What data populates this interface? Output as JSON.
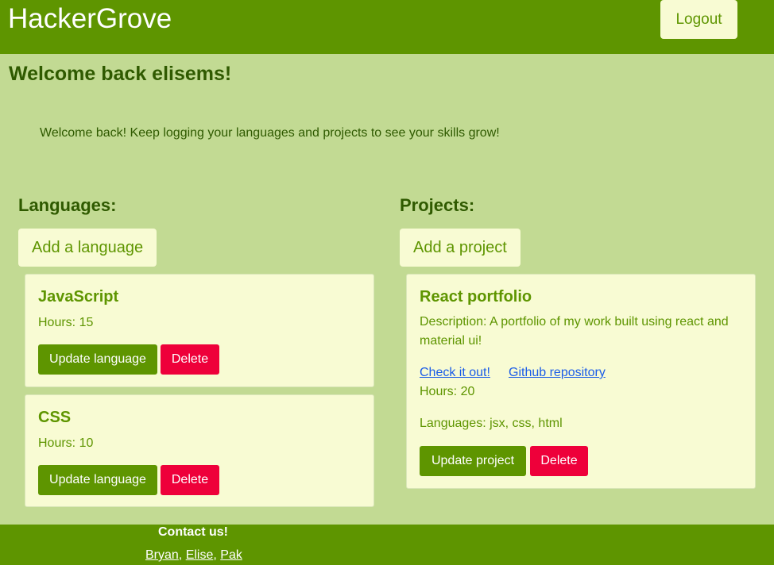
{
  "header": {
    "brand": "HackerGrove",
    "logout_label": "Logout"
  },
  "welcome": {
    "title": "Welcome back elisems!",
    "message": "Welcome back! Keep logging your languages and projects to see your skills grow!"
  },
  "languages": {
    "heading": "Languages:",
    "add_label": "Add a language",
    "items": [
      {
        "name": "JavaScript",
        "hours": "Hours: 15",
        "update_label": "Update language",
        "delete_label": "Delete"
      },
      {
        "name": "CSS",
        "hours": "Hours: 10",
        "update_label": "Update language",
        "delete_label": "Delete"
      }
    ]
  },
  "projects": {
    "heading": "Projects:",
    "add_label": "Add a project",
    "items": [
      {
        "name": "React portfolio",
        "description_line1": "Description: A portfolio of my work built using react and",
        "description_line2": "material ui!",
        "link_live": "Check it out!",
        "link_repo": "Github repository",
        "hours": "Hours: 20",
        "languages": "Languages: jsx, css, html",
        "update_label": "Update project",
        "delete_label": "Delete"
      }
    ]
  },
  "footer": {
    "title": "Contact us!",
    "contacts": [
      "Bryan",
      "Elise",
      "Pak"
    ],
    "separator": ", "
  },
  "colors": {
    "background": "#c2da93",
    "primary_green": "#5e9500",
    "card_bg": "#f8fbd3",
    "danger": "#ee003a",
    "link": "#1a5ce8"
  }
}
